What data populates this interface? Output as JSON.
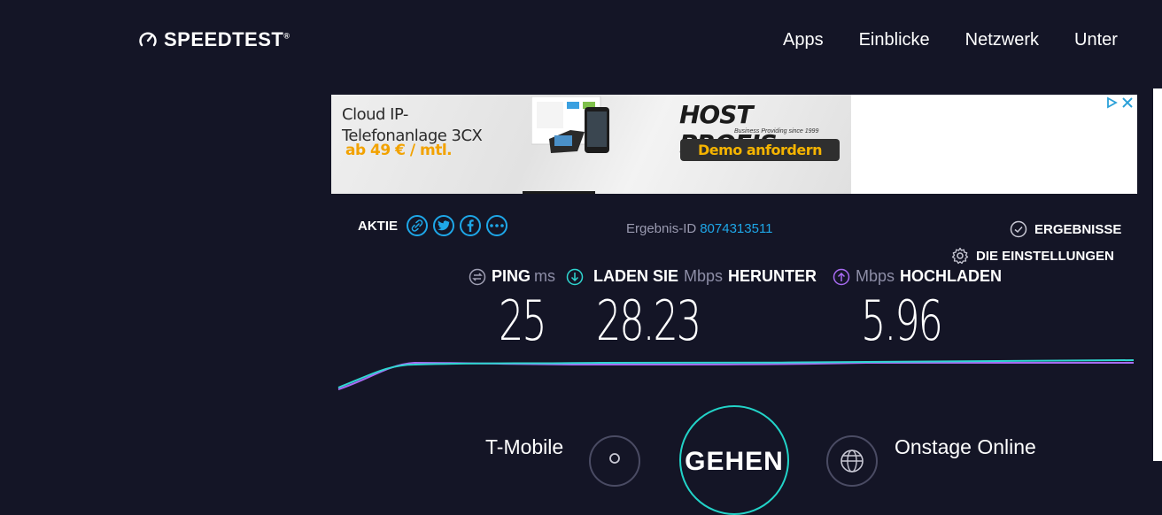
{
  "brand": {
    "name": "SPEEDTEST",
    "trademark": "®"
  },
  "nav": {
    "items": [
      "Apps",
      "Einblicke",
      "Netzwerk",
      "Unter"
    ]
  },
  "ad": {
    "line1": "Cloud IP-",
    "line2": "Telefonanlage 3CX",
    "price": "ab 49 € / mtl.",
    "brand": "HOST PROFIS",
    "brand_registered": "®",
    "brand_tagline": "Business Providing since 1999",
    "cta": "Demo anfordern"
  },
  "share": {
    "label": "AKTIE",
    "icons": [
      "link-icon",
      "twitter-icon",
      "facebook-icon",
      "more-icon"
    ]
  },
  "result": {
    "id_label": "Ergebnis-ID",
    "id_value": "8074313511"
  },
  "links": {
    "results": "ERGEBNISSE",
    "settings": "DIE EINSTELLUNGEN"
  },
  "metrics": {
    "ping": {
      "label": "PING",
      "unit": "ms",
      "value": "25"
    },
    "download": {
      "label": "LADEN SIE",
      "unit": "Mbps",
      "label2": "HERUNTER",
      "value": "28.23"
    },
    "upload": {
      "unit": "Mbps",
      "label": "HOCHLADEN",
      "value": "5.96"
    }
  },
  "bottom": {
    "isp": "T-Mobile",
    "go_label": "GEHEN",
    "server": "Onstage Online"
  },
  "colors": {
    "background": "#141526",
    "accent_blue": "#1ea7e8",
    "download_line": "#2fd6d0",
    "upload_line": "#a86bf2",
    "go_ring": "#22d3c8"
  }
}
